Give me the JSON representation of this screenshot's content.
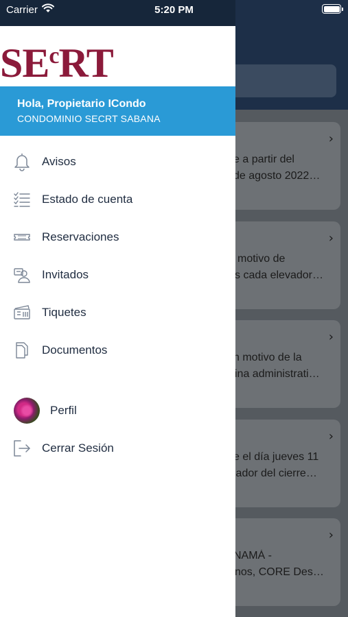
{
  "status_bar": {
    "carrier": "Carrier",
    "time": "5:20 PM"
  },
  "drawer": {
    "logo_main": "SE",
    "logo_small": "c",
    "logo_end": "RT",
    "greeting": "Hola, Propietario ICondo",
    "condominium": "CONDOMINIO SECRT SABANA",
    "menu": [
      {
        "label": "Avisos",
        "icon": "bell-icon"
      },
      {
        "label": "Estado de cuenta",
        "icon": "checklist-icon"
      },
      {
        "label": "Reservaciones",
        "icon": "ticket-icon"
      },
      {
        "label": "Invitados",
        "icon": "guests-icon"
      },
      {
        "label": "Tiquetes",
        "icon": "tickets-icon"
      },
      {
        "label": "Documentos",
        "icon": "documents-icon"
      }
    ],
    "profile_label": "Perfil",
    "logout_label": "Cerrar Sesión"
  },
  "background_cards": [
    {
      "line1": "e a partir del",
      "line2": "de agosto 2022…"
    },
    {
      "line1": "motivo de",
      "line2": "s cada elevador…"
    },
    {
      "line1": "n motivo de la",
      "line2": "ina administrati…"
    },
    {
      "line1": "e el día jueves 11",
      "line2": "lador del cierre…"
    },
    {
      "line1": "NAMÁ -",
      "line2": "nos, CORE Des…"
    }
  ],
  "colors": {
    "header_navy": "#16263a",
    "banner_blue": "#2a9ad6",
    "logo_maroon": "#8b1a3a",
    "menu_text": "#1f2c40"
  }
}
